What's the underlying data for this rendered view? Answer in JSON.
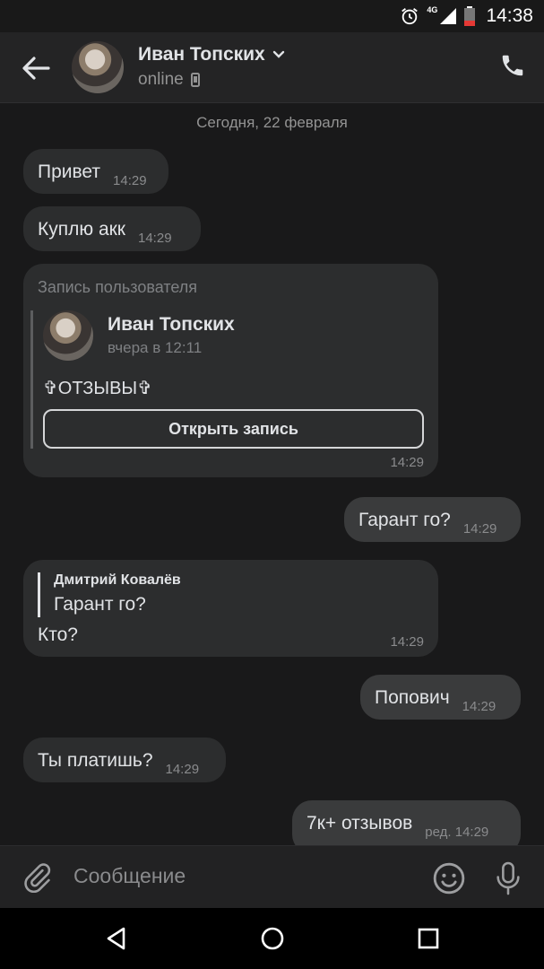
{
  "status": {
    "network": "4G",
    "time": "14:38"
  },
  "header": {
    "name": "Иван Топских",
    "presence": "online"
  },
  "date_divider": "Сегодня, 22 февраля",
  "messages": [
    {
      "text": "Привет",
      "time": "14:29"
    },
    {
      "text": "Куплю акк",
      "time": "14:29"
    }
  ],
  "repost": {
    "label": "Запись пользователя",
    "author": "Иван Топских",
    "date": "вчера в 12:11",
    "text": "✞ОТЗЫВЫ✞",
    "button": "Открыть запись",
    "time": "14:29"
  },
  "out1": {
    "text": "Гарант го?",
    "time": "14:29"
  },
  "reply_msg": {
    "reply_author": "Дмитрий Ковалёв",
    "reply_text": "Гарант го?",
    "text": "Кто?",
    "time": "14:29"
  },
  "out2": {
    "text": "Попович",
    "time": "14:29"
  },
  "in3": {
    "text": "Ты платишь?",
    "time": "14:29"
  },
  "out3": {
    "text": "7к+ отзывов",
    "edited": "ред.",
    "time": "14:29"
  },
  "composer": {
    "placeholder": "Сообщение"
  }
}
